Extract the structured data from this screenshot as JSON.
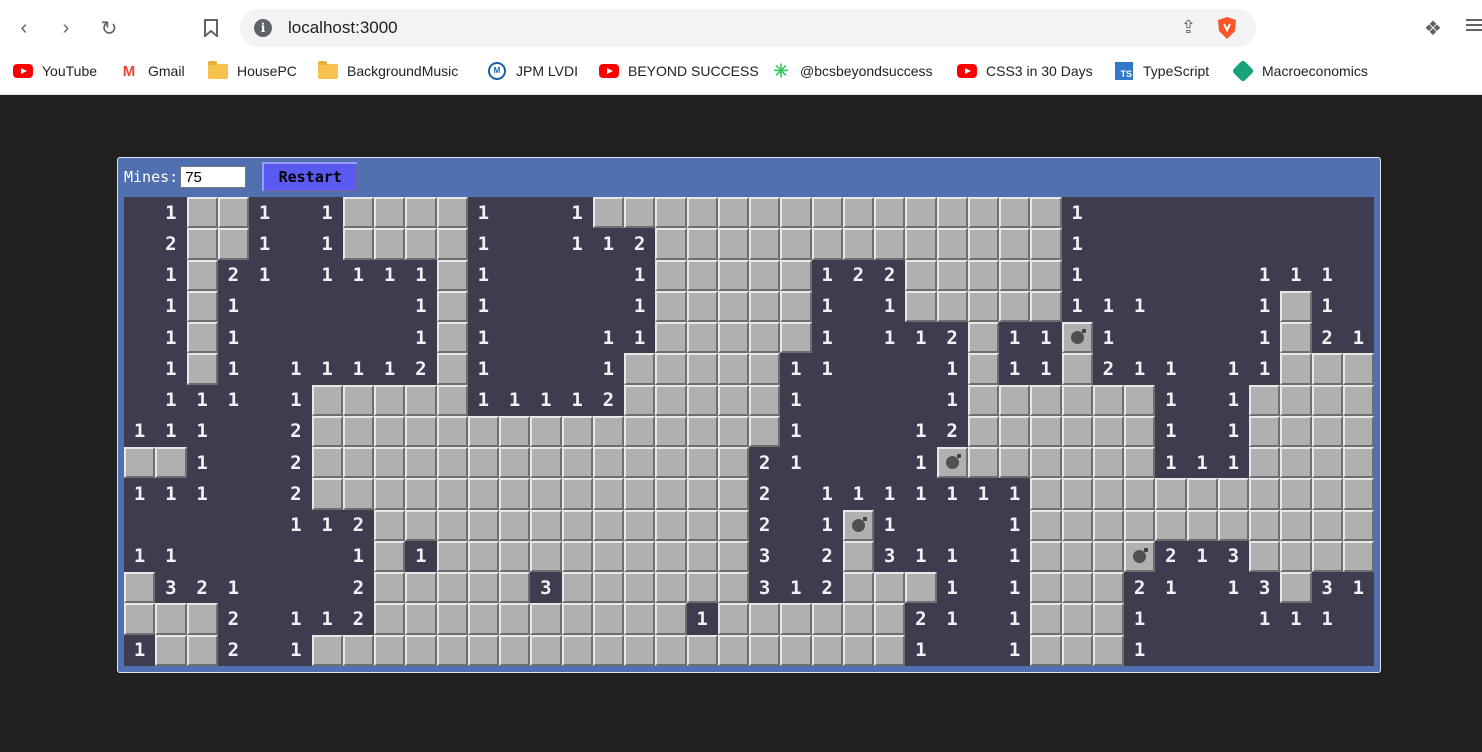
{
  "browser": {
    "url": "localhost:3000",
    "bookmarks": [
      {
        "label": "YouTube",
        "icon": "youtube-icon"
      },
      {
        "label": "Gmail",
        "icon": "gmail-icon"
      },
      {
        "label": "HousePC",
        "icon": "folder-icon"
      },
      {
        "label": "BackgroundMusic",
        "icon": "folder-icon"
      },
      {
        "label": "JPM LVDI",
        "icon": "jpm-icon"
      },
      {
        "label": "BEYOND SUCCESS",
        "icon": "youtube-icon"
      },
      {
        "label": "@bcsbeyondsuccess",
        "icon": "asterisk-icon"
      },
      {
        "label": "CSS3 in 30 Days",
        "icon": "youtube-icon"
      },
      {
        "label": "TypeScript",
        "icon": "typescript-icon"
      },
      {
        "label": "Macroeconomics",
        "icon": "macro-icon"
      }
    ]
  },
  "game": {
    "mines_label": "Mines:",
    "mines_value": "75",
    "restart_label": "Restart",
    "legend": "H = hidden tile, . = revealed empty, digit = revealed count, * = mine",
    "board": [
      ". 1 H H 1 . 1 H H H H 1 . . 1 H H H H H H H H H H H H H H H 1 . . . . . . . . .",
      ". 2 H H 1 . 1 H H H H 1 . . 1 1 2 H H H H H H H H H H H H H 1 . . . . . . . . .",
      ". 1 H 2 1 . 1 1 1 1 H 1 . . . . 1 H H H H H 1 2 2 H H H H H 1 . . . . . 1 1 1 .",
      ". 1 H 1 . . . . . 1 H 1 . . . . 1 H H H H H 1 . 1 H H H H H 1 1 1 . . . 1 H 1 .",
      ". 1 H 1 . . . . . 1 H 1 . . . 1 1 H H H H H 1 . 1 1 2 H 1 1 * 1 . . . . 1 H 2 1",
      ". 1 H 1 . 1 1 1 1 2 H 1 . . . 1 H H H H H 1 1 . . . 1 H 1 1 H 2 1 1 . 1 1 H H H",
      ". 1 1 1 . 1 H H H H H 1 1 1 1 2 H H H H H 1 . . . . 1 H H H H H H 1 . 1 H H H H",
      "1 1 1 . . 2 H H H H H H H H H H H H H H H 1 . . . 1 2 H H H H H H 1 . 1 H H H H",
      "H H 1 . . 2 H H H H H H H H H H H H H H 2 1 . . . 1 * H H H H H H 1 1 1 H H H H",
      "1 1 1 . . 2 H H H H H H H H H H H H H H 2 . 1 1 1 1 1 1 1 H H H H H H H H H H H",
      ". . . . . 1 1 2 H H H H H H H H H H H H 2 . 1 * 1 . . . 1 H H H H H H H H H H H",
      "1 1 . . . . . 1 H 1 H H H H H H H H H H 3 . 2 H 3 1 1 . 1 H H H * 2 1 3 H H H H",
      "H 3 2 1 . . . 2 H H H H H 3 H H H H H H 3 1 2 H H H 1 . 1 H H H 2 1 . 1 3 H 3 1",
      "H H H 2 . 1 1 2 H H H H H H H H H H 1 H H H H H H 2 1 . 1 H H H 1 . . . 1 1 1 .",
      "1 H H 2 . 1 H H H H H H H H H H H H H H H H H H H 1 . . 1 H H H 1 . . . . . . ."
    ]
  }
}
